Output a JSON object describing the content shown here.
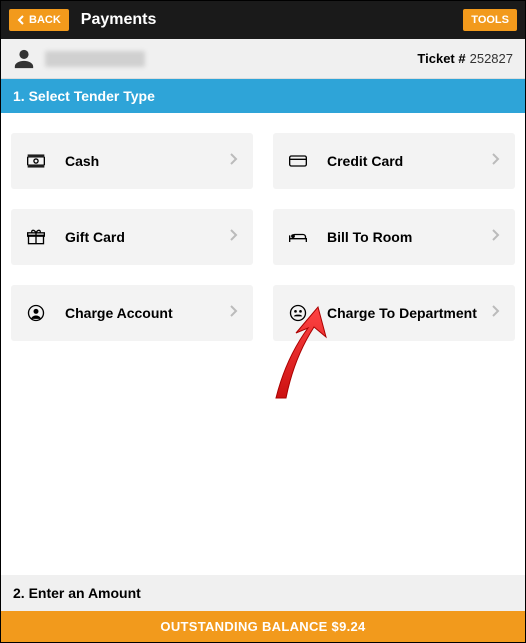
{
  "header": {
    "back_label": "BACK",
    "title": "Payments",
    "tools_label": "TOOLS"
  },
  "user": {
    "ticket_label": "Ticket #",
    "ticket_number": "252827"
  },
  "step1": {
    "title": "1. Select Tender Type"
  },
  "tenders": {
    "cash": "Cash",
    "credit_card": "Credit Card",
    "gift_card": "Gift Card",
    "bill_to_room": "Bill To Room",
    "charge_account": "Charge Account",
    "charge_to_department": "Charge To Department"
  },
  "step2": {
    "title": "2. Enter an Amount"
  },
  "footer": {
    "balance_label": "OUTSTANDING BALANCE $9.24"
  }
}
